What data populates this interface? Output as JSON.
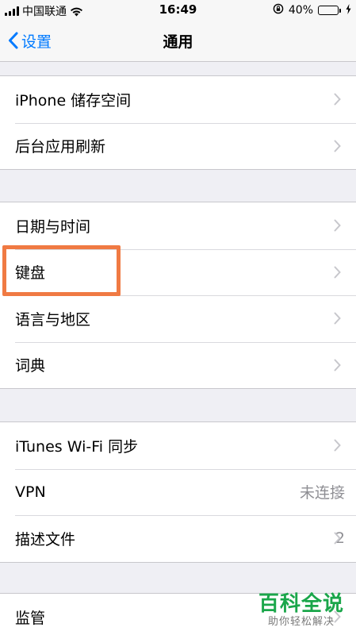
{
  "status_bar": {
    "carrier": "中国联通",
    "time": "16:49",
    "battery": "40%",
    "battery_level": 0.4
  },
  "nav": {
    "back_label": "设置",
    "title": "通用"
  },
  "groups": [
    {
      "rows": [
        {
          "label": "iPhone 储存空间",
          "detail": ""
        },
        {
          "label": "后台应用刷新",
          "detail": ""
        }
      ]
    },
    {
      "rows": [
        {
          "label": "日期与时间",
          "detail": ""
        },
        {
          "label": "键盘",
          "detail": ""
        },
        {
          "label": "语言与地区",
          "detail": ""
        },
        {
          "label": "词典",
          "detail": ""
        }
      ]
    },
    {
      "rows": [
        {
          "label": "iTunes Wi-Fi 同步",
          "detail": ""
        },
        {
          "label": "VPN",
          "detail": "未连接"
        },
        {
          "label": "描述文件",
          "detail": "2"
        }
      ]
    },
    {
      "rows": [
        {
          "label": "监管",
          "detail": ""
        }
      ]
    }
  ],
  "colors": {
    "accent": "#007aff",
    "highlight": "#f07a43",
    "watermark": "#1aa64a"
  },
  "watermark": {
    "title": "百科全说",
    "subtitle": "助你轻松解决"
  }
}
